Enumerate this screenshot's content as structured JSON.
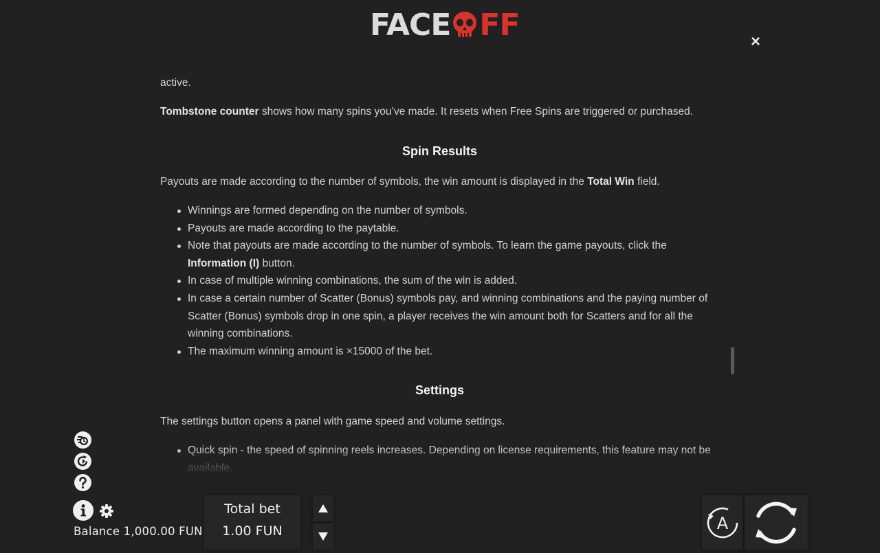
{
  "logo": {
    "part1": "FACE",
    "part2": "FF"
  },
  "close_label": "×",
  "rules": {
    "line_active": "active.",
    "tombstone_bold": "Tombstone counter",
    "tombstone_rest": " shows how many spins you’ve made. It resets when Free Spins are triggered or purchased.",
    "spin_results_title": "Spin Results",
    "payouts_intro_a": "Payouts are made according to the number of symbols, the win amount is displayed in the ",
    "payouts_intro_bold": "Total Win",
    "payouts_intro_b": " field.",
    "bullets": {
      "b1": "Winnings are formed depending on the number of symbols.",
      "b2": "Payouts are made according to the paytable.",
      "b3_a": "Note that payouts are made according to the number of symbols. To learn the game payouts, click the ",
      "b3_bold": "Information (I)",
      "b3_b": " button.",
      "b4": "In case of multiple winning combinations, the sum of the win is added.",
      "b5": "In case a certain number of Scatter (Bonus) symbols pay, and winning combinations and the paying number of Scatter (Bonus) symbols drop in one spin, a player receives the win amount both for Scatters and for all the winning combinations.",
      "b6": "The maximum winning amount is ×15000 of the bet."
    },
    "settings_title": "Settings",
    "settings_intro": "The settings button opens a panel with game speed and volume settings.",
    "settings_bullets": {
      "s1": "Quick spin - the speed of spinning reels increases. Depending on license requirements, this feature may not be available."
    }
  },
  "footer": {
    "balance": "Balance 1,000.00 FUN",
    "total_bet_label": "Total bet",
    "total_bet_value": "1.00 FUN",
    "autoplay_letter": "A"
  },
  "colors": {
    "logo_red": "#d8342c",
    "background": "#212121"
  }
}
